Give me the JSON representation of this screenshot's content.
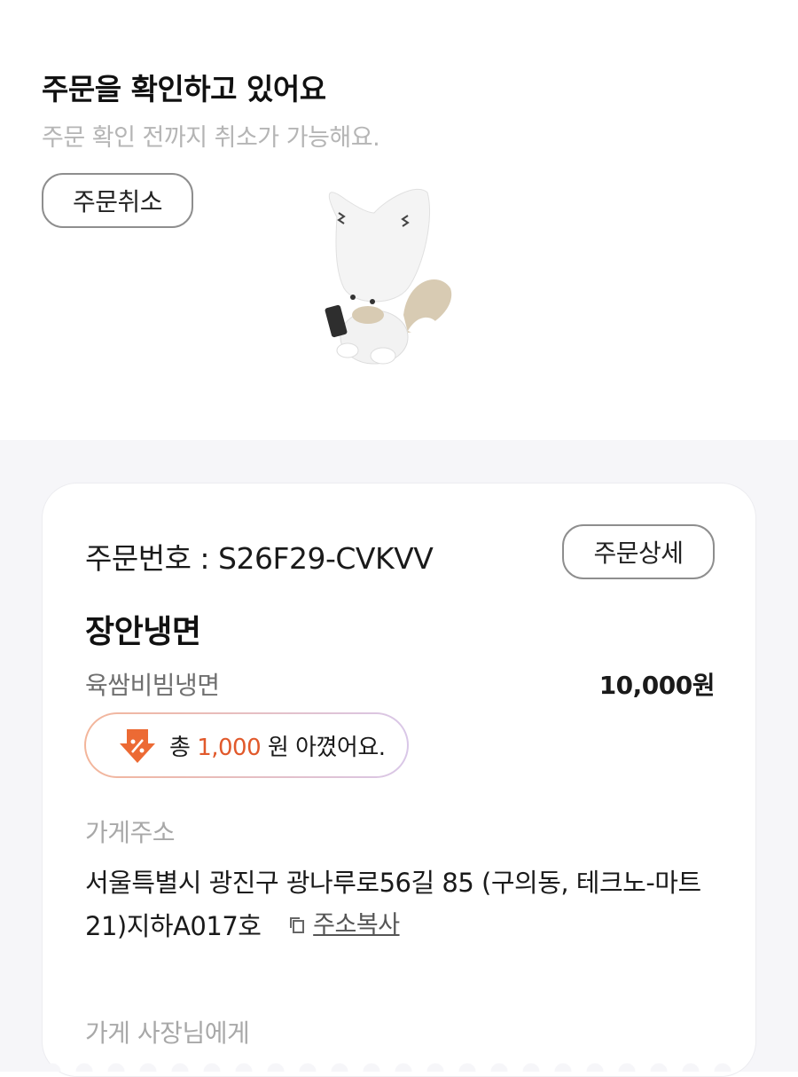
{
  "header": {
    "title": "주문을 확인하고 있어요",
    "subtitle": "주문 확인 전까지 취소가 가능해요.",
    "cancel_label": "주문취소"
  },
  "order": {
    "number_text": "주문번호 : S26F29-CVKVV",
    "detail_label": "주문상세",
    "store_name": "장안냉면",
    "menu_name": "육쌈비빔냉면",
    "menu_price": "10,000원",
    "saving": {
      "prefix": "총 ",
      "amount": "1,000",
      "suffix": " 원 아꼈어요.",
      "accent": "#e1592b"
    }
  },
  "store_address": {
    "label": "가게주소",
    "value": "서울특별시 광진구 광나루로56길 85 (구의동, 테크노-마트21)지하A017호",
    "copy_label": "주소복사"
  },
  "owner_note": {
    "label": "가게 사장님에게"
  },
  "icons": [
    "mascot-fox-icon",
    "discount-arrow-icon",
    "copy-icon"
  ]
}
